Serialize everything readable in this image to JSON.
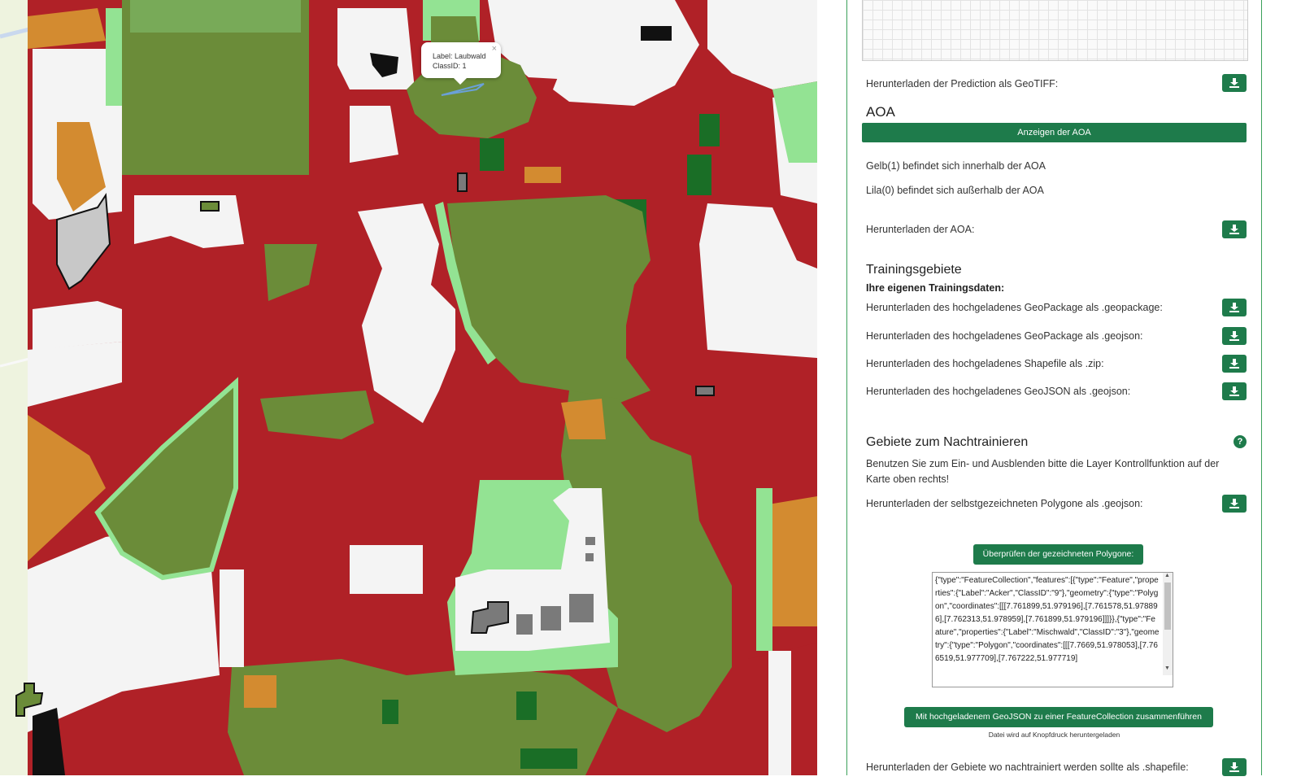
{
  "map": {
    "popup": {
      "label_line": "Label: Laubwald",
      "class_line": "ClassID: 1",
      "close": "×"
    },
    "colors": {
      "red": "#b02127",
      "olive": "#6b8c39",
      "white": "#f4f4f4",
      "light_green": "#93e393",
      "orange": "#d38b30",
      "dark_green": "#1a6e26",
      "gray": "#7a7a7a",
      "black": "#111111",
      "osm_base": "#eef3df"
    }
  },
  "panel": {
    "prediction_download_label": "Herunterladen der Prediction als GeoTIFF:",
    "aoa_heading": "AOA",
    "aoa_show_button": "Anzeigen der AOA",
    "aoa_inside": "Gelb(1) befindet sich innerhalb der AOA",
    "aoa_outside": "Lila(0) befindet sich außerhalb der AOA",
    "aoa_download_label": "Herunterladen der AOA:",
    "training_heading": "Trainingsgebiete",
    "training_subheading": "Ihre eigenen Trainingsdaten:",
    "training_downloads": [
      "Herunterladen des hochgeladenes GeoPackage als .geopackage:",
      "Herunterladen des hochgeladenes GeoPackage als .geojson:",
      "Herunterladen des hochgeladenes Shapefile als .zip:",
      "Herunterladen des hochgeladenes GeoJSON als .geojson:"
    ],
    "retrain_heading": "Gebiete zum Nachtrainieren",
    "help_icon": "?",
    "retrain_info": "Benutzen Sie zum Ein- und Ausblenden bitte die Layer Kontrollfunktion auf der Karte oben rechts!",
    "drawn_download_label": "Herunterladen der selbstgezeichneten Polygone als .geojson:",
    "check_button": "Überprüfen der gezeichneten Polygone:",
    "geojson_text": "{\"type\":\"FeatureCollection\",\"features\":[{\"type\":\"Feature\",\"properties\":{\"Label\":\"Acker\",\"ClassID\":\"9\"},\"geometry\":{\"type\":\"Polygon\",\"coordinates\":[[[7.761899,51.979196],[7.761578,51.978896],[7.762313,51.978959],[7.761899,51.979196]]]}},{\"type\":\"Feature\",\"properties\":{\"Label\":\"Mischwald\",\"ClassID\":\"3\"},\"geometry\":{\"type\":\"Polygon\",\"coordinates\":[[[7.7669,51.978053],[7.766519,51.977709],[7.767222,51.977719]",
    "merge_button": "Mit hochgeladenem GeoJSON zu einer FeatureCollection zusammenführen",
    "merge_note": "Datei wird auf Knopfdruck heruntergeladen",
    "shapefile_download_label": "Herunterladen der Gebiete wo nachtrainiert werden sollte als .shapefile:",
    "download_icon": "download-icon"
  }
}
